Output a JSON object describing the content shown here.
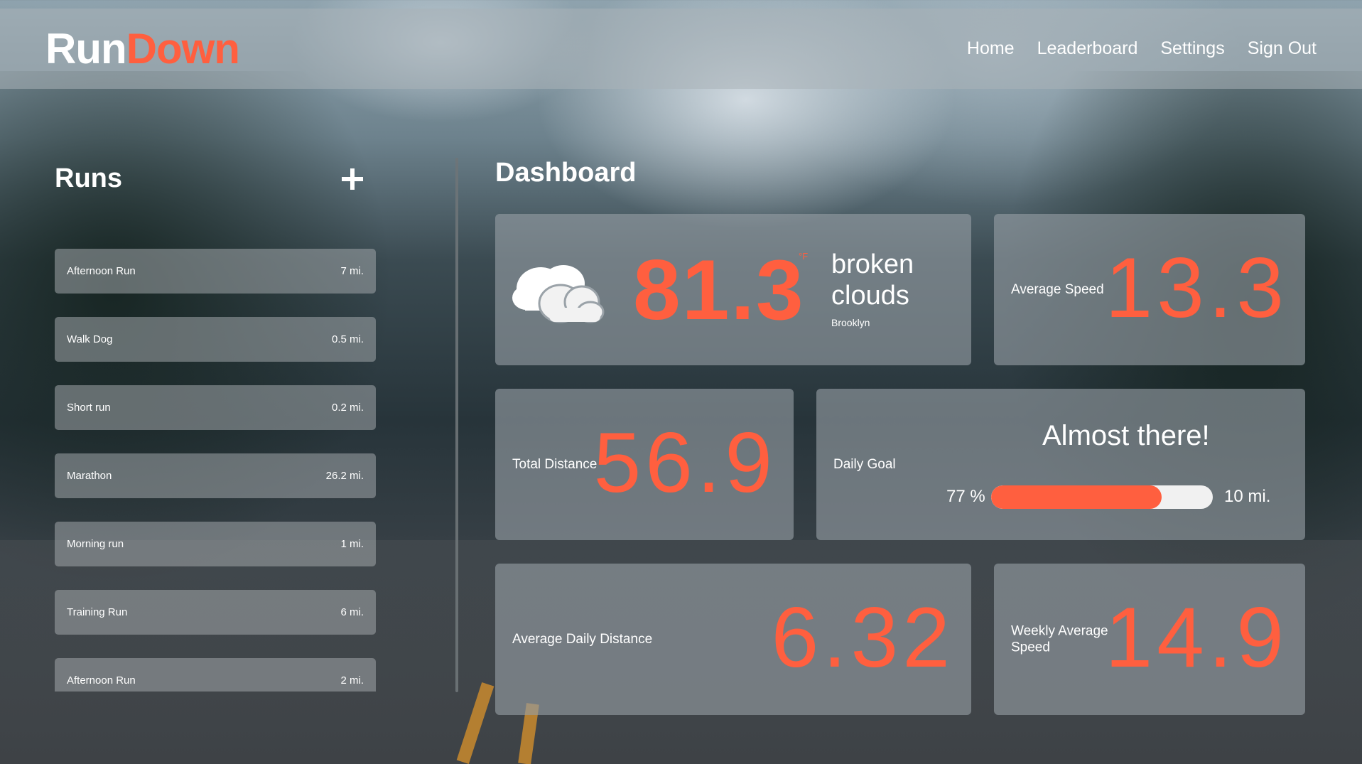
{
  "app": {
    "logo_part1": "Run",
    "logo_part2": "Down",
    "accent_color": "#ff5f3f"
  },
  "nav": {
    "items": [
      {
        "label": "Home"
      },
      {
        "label": "Leaderboard"
      },
      {
        "label": "Settings"
      },
      {
        "label": "Sign Out"
      }
    ]
  },
  "sidebar": {
    "title": "Runs",
    "add_icon": "plus-icon",
    "runs": [
      {
        "name": "Afternoon Run",
        "distance": "7 mi."
      },
      {
        "name": "Walk Dog",
        "distance": "0.5 mi."
      },
      {
        "name": "Short run",
        "distance": "0.2 mi."
      },
      {
        "name": "Marathon",
        "distance": "26.2 mi."
      },
      {
        "name": "Morning run",
        "distance": "1 mi."
      },
      {
        "name": "Training Run",
        "distance": "6 mi."
      },
      {
        "name": "Afternoon Run",
        "distance": "2 mi."
      }
    ]
  },
  "dashboard": {
    "title": "Dashboard",
    "weather": {
      "icon": "cloud-icon",
      "temperature": "81.3",
      "unit": "°F",
      "description": "broken clouds",
      "city": "Brooklyn"
    },
    "average_speed": {
      "label": "Average Speed",
      "value": "13.3"
    },
    "total_distance": {
      "label": "Total Distance",
      "value": "56.9"
    },
    "daily_goal": {
      "label": "Daily Goal",
      "heading": "Almost there!",
      "percent_text": "77 %",
      "progress": 0.77,
      "target": "10 mi."
    },
    "average_daily_distance": {
      "label": "Average Daily Distance",
      "value": "6.32"
    },
    "weekly_average_speed": {
      "label": "Weekly Average Speed",
      "value": "14.9"
    }
  }
}
